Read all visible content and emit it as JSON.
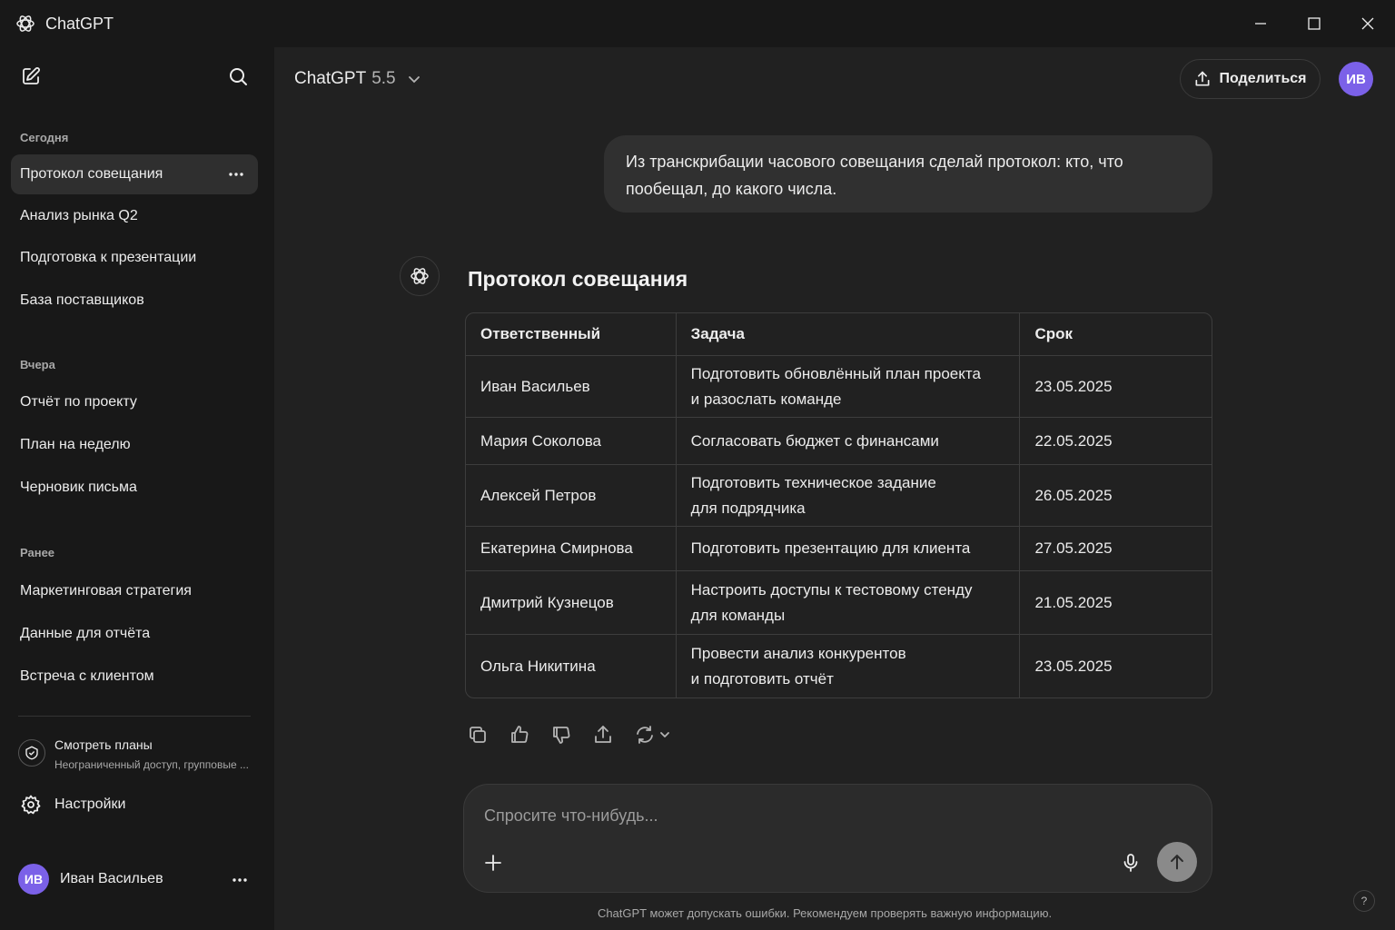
{
  "app": {
    "title": "ChatGPT"
  },
  "sidebar": {
    "sections": [
      {
        "label": "Сегодня",
        "items": [
          {
            "label": "Протокол совещания"
          },
          {
            "label": "Анализ рынка Q2"
          },
          {
            "label": "Подготовка к презентации"
          },
          {
            "label": "База поставщиков"
          }
        ]
      },
      {
        "label": "Вчера",
        "items": [
          {
            "label": "Отчёт по проекту"
          },
          {
            "label": "План на неделю"
          },
          {
            "label": "Черновик письма"
          }
        ]
      },
      {
        "label": "Ранее",
        "items": [
          {
            "label": "Маркетинговая стратегия"
          },
          {
            "label": "Данные для отчёта"
          },
          {
            "label": "Встреча с клиентом"
          }
        ]
      }
    ],
    "active_item": "Протокол совещания",
    "plans": {
      "title": "Смотреть планы",
      "subtitle": "Неограниченный доступ, групповые ..."
    },
    "settings_label": "Настройки",
    "user": {
      "initials": "ИВ",
      "name": "Иван Васильев"
    }
  },
  "header": {
    "model_name": "ChatGPT",
    "model_version": "5.5",
    "share_label": "Поделиться",
    "avatar_initials": "ИВ"
  },
  "conversation": {
    "user_message": "Из транскрибации часового совещания сделай протокол: кто, что пообещал, до какого числа.",
    "assistant": {
      "title": "Протокол совещания",
      "table": {
        "headers": [
          "Ответственный",
          "Задача",
          "Срок"
        ],
        "rows": [
          {
            "person": "Иван Васильев",
            "task": [
              "Подготовить обновлённый план проекта",
              "и разослать команде"
            ],
            "due": "23.05.2025"
          },
          {
            "person": "Мария Соколова",
            "task": [
              "Согласовать бюджет с финансами"
            ],
            "due": "22.05.2025"
          },
          {
            "person": "Алексей Петров",
            "task": [
              "Подготовить техническое задание",
              "для подрядчика"
            ],
            "due": "26.05.2025"
          },
          {
            "person": "Екатерина Смирнова",
            "task": [
              "Подготовить презентацию для клиента"
            ],
            "due": "27.05.2025"
          },
          {
            "person": "Дмитрий Кузнецов",
            "task": [
              "Настроить доступы к тестовому стенду",
              "для команды"
            ],
            "due": "21.05.2025"
          },
          {
            "person": "Ольга Никитина",
            "task": [
              "Провести анализ конкурентов",
              "и подготовить отчёт"
            ],
            "due": "23.05.2025"
          }
        ]
      }
    }
  },
  "composer": {
    "placeholder": "Спросите что-нибудь..."
  },
  "footer": {
    "disclaimer": "ChatGPT может допускать ошибки. Рекомендуем проверять важную информацию.",
    "help": "?"
  },
  "colors": {
    "background": "#212121",
    "sidebar": "#181818",
    "accent_avatar": "#7b61e8",
    "active_item": "#2f2f2f"
  }
}
